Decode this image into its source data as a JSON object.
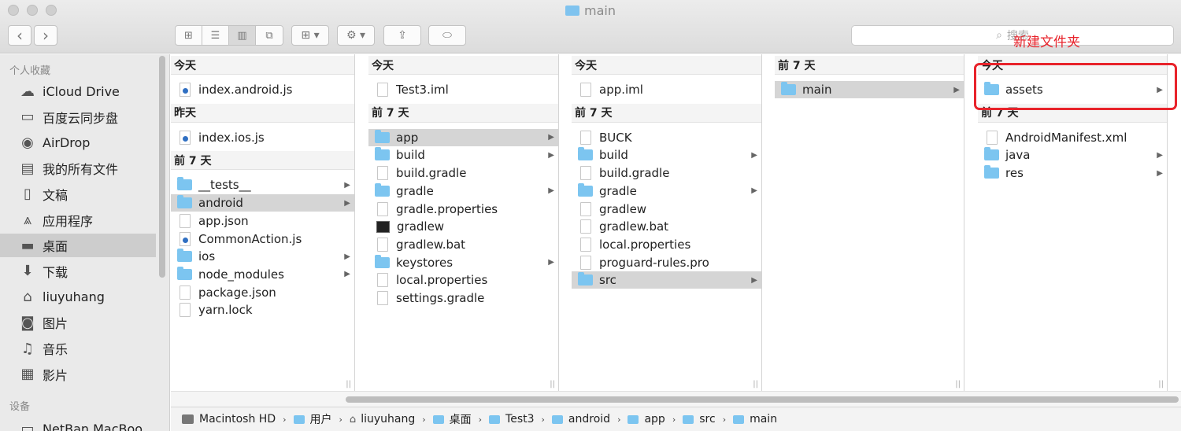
{
  "window": {
    "title": "main"
  },
  "toolbar": {
    "back": "‹",
    "forward": "›",
    "search_placeholder": "搜索"
  },
  "annotation": {
    "text": "新建文件夹",
    "color": "#e8232b"
  },
  "sidebar": {
    "favorites_header": "个人收藏",
    "devices_header": "设备",
    "items": [
      {
        "label": "iCloud Drive",
        "icon": "cloud-icon"
      },
      {
        "label": "百度云同步盘",
        "icon": "folder-icon"
      },
      {
        "label": "AirDrop",
        "icon": "airdrop-icon"
      },
      {
        "label": "我的所有文件",
        "icon": "all-files-icon"
      },
      {
        "label": "文稿",
        "icon": "documents-icon"
      },
      {
        "label": "应用程序",
        "icon": "applications-icon"
      },
      {
        "label": "桌面",
        "icon": "desktop-icon"
      },
      {
        "label": "下载",
        "icon": "download-icon"
      },
      {
        "label": "liuyuhang",
        "icon": "home-icon"
      },
      {
        "label": "图片",
        "icon": "camera-icon"
      },
      {
        "label": "音乐",
        "icon": "music-icon"
      },
      {
        "label": "影片",
        "icon": "film-icon"
      }
    ],
    "device": "NetBan.MacBoo..."
  },
  "columns": [
    {
      "sections": [
        {
          "header": "今天",
          "rows": [
            {
              "name": "index.android.js",
              "type": "js"
            }
          ]
        },
        {
          "header": "昨天",
          "rows": [
            {
              "name": "index.ios.js",
              "type": "js"
            }
          ]
        },
        {
          "header": "前 7 天",
          "rows": [
            {
              "name": "__tests__",
              "type": "folder",
              "chevron": true
            },
            {
              "name": "android",
              "type": "folder",
              "chevron": true,
              "selected": true
            },
            {
              "name": "app.json",
              "type": "doc"
            },
            {
              "name": "CommonAction.js",
              "type": "js"
            },
            {
              "name": "ios",
              "type": "folder",
              "chevron": true
            },
            {
              "name": "node_modules",
              "type": "folder",
              "chevron": true
            },
            {
              "name": "package.json",
              "type": "doc"
            },
            {
              "name": "yarn.lock",
              "type": "doc"
            }
          ]
        }
      ]
    },
    {
      "sections": [
        {
          "header": "今天",
          "rows": [
            {
              "name": "Test3.iml",
              "type": "doc"
            }
          ]
        },
        {
          "header": "前 7 天",
          "rows": [
            {
              "name": "app",
              "type": "folder",
              "chevron": true,
              "selected": true
            },
            {
              "name": "build",
              "type": "folder",
              "chevron": true
            },
            {
              "name": "build.gradle",
              "type": "doc"
            },
            {
              "name": "gradle",
              "type": "folder",
              "chevron": true
            },
            {
              "name": "gradle.properties",
              "type": "doc"
            },
            {
              "name": "gradlew",
              "type": "exec"
            },
            {
              "name": "gradlew.bat",
              "type": "doc"
            },
            {
              "name": "keystores",
              "type": "folder",
              "chevron": true
            },
            {
              "name": "local.properties",
              "type": "doc"
            },
            {
              "name": "settings.gradle",
              "type": "doc"
            }
          ]
        }
      ]
    },
    {
      "sections": [
        {
          "header": "今天",
          "rows": [
            {
              "name": "app.iml",
              "type": "doc"
            }
          ]
        },
        {
          "header": "前 7 天",
          "rows": [
            {
              "name": "BUCK",
              "type": "doc"
            },
            {
              "name": "build",
              "type": "folder",
              "chevron": true
            },
            {
              "name": "build.gradle",
              "type": "doc"
            },
            {
              "name": "gradle",
              "type": "folder",
              "chevron": true
            },
            {
              "name": "gradlew",
              "type": "doc"
            },
            {
              "name": "gradlew.bat",
              "type": "doc"
            },
            {
              "name": "local.properties",
              "type": "doc"
            },
            {
              "name": "proguard-rules.pro",
              "type": "doc"
            },
            {
              "name": "src",
              "type": "folder",
              "chevron": true,
              "selected": true
            }
          ]
        }
      ]
    },
    {
      "sections": [
        {
          "header": "前 7 天",
          "rows": [
            {
              "name": "main",
              "type": "folder",
              "chevron": true,
              "selected": true
            }
          ]
        }
      ]
    },
    {
      "sections": [
        {
          "header": "今天",
          "rows": [
            {
              "name": "assets",
              "type": "folder",
              "chevron": true
            }
          ]
        },
        {
          "header": "前 7 天",
          "rows": [
            {
              "name": "AndroidManifest.xml",
              "type": "doc"
            },
            {
              "name": "java",
              "type": "folder",
              "chevron": true
            },
            {
              "name": "res",
              "type": "folder",
              "chevron": true
            }
          ]
        }
      ]
    }
  ],
  "path": [
    {
      "label": "Macintosh HD",
      "icon": "hard-drive-icon"
    },
    {
      "label": "用户",
      "icon": "folder-icon"
    },
    {
      "label": "liuyuhang",
      "icon": "home-icon"
    },
    {
      "label": "桌面",
      "icon": "folder-icon"
    },
    {
      "label": "Test3",
      "icon": "folder-icon"
    },
    {
      "label": "android",
      "icon": "folder-icon"
    },
    {
      "label": "app",
      "icon": "folder-icon"
    },
    {
      "label": "src",
      "icon": "folder-icon"
    },
    {
      "label": "main",
      "icon": "folder-icon"
    }
  ]
}
